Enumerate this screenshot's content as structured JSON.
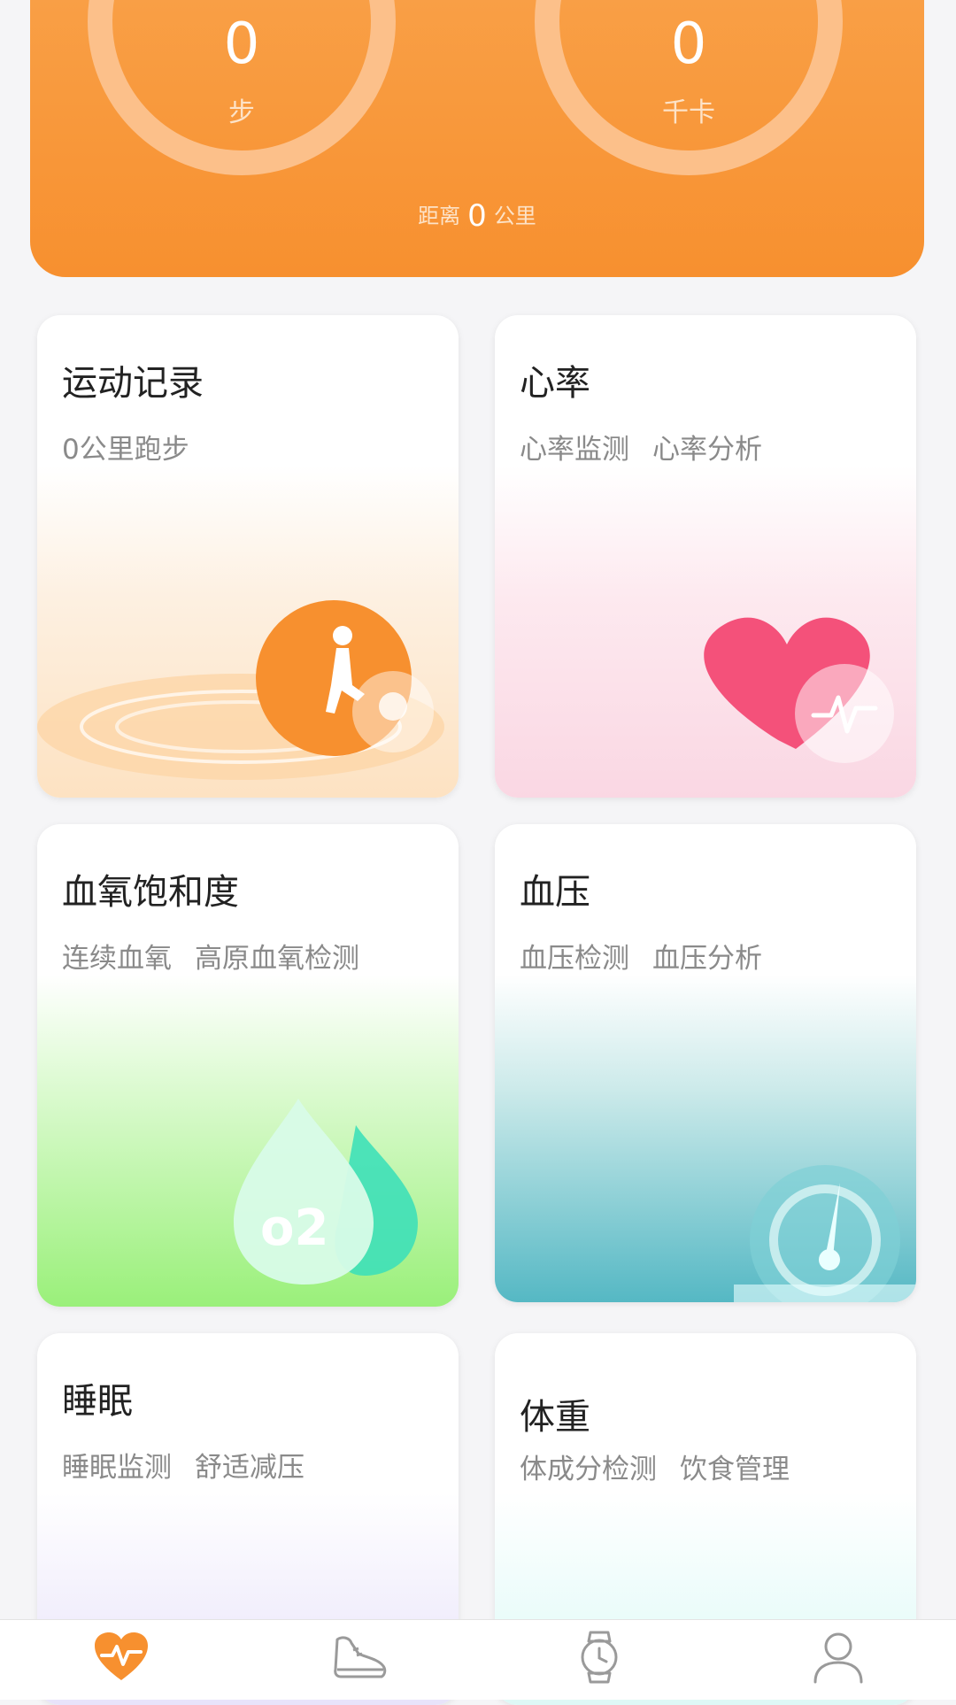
{
  "summary": {
    "steps_value": "0",
    "steps_unit": "步",
    "calories_value": "0",
    "calories_unit": "千卡",
    "distance_label": "距离",
    "distance_value": "0",
    "distance_unit": "公里",
    "accent": "#f7902f"
  },
  "cards": [
    {
      "title": "运动记录",
      "subs": [
        "0公里跑步"
      ]
    },
    {
      "title": "心率",
      "subs": [
        "心率监测",
        "心率分析"
      ]
    },
    {
      "title": "血氧饱和度",
      "subs": [
        "连续血氧",
        "高原血氧检测"
      ]
    },
    {
      "title": "血压",
      "subs": [
        "血压检测",
        "血压分析"
      ]
    },
    {
      "title": "睡眠",
      "subs": [
        "睡眠监测",
        "舒适减压"
      ]
    },
    {
      "title": "体重",
      "subs": [
        "体成分检测",
        "饮食管理"
      ]
    }
  ],
  "art": {
    "o2_label": "o2"
  },
  "nav": {
    "items": [
      {
        "icon": "heart-pulse-icon",
        "active": true
      },
      {
        "icon": "shoe-icon",
        "active": false
      },
      {
        "icon": "watch-icon",
        "active": false
      },
      {
        "icon": "user-icon",
        "active": false
      }
    ],
    "active_color": "#f7902f",
    "inactive_color": "#9a9a9a"
  }
}
